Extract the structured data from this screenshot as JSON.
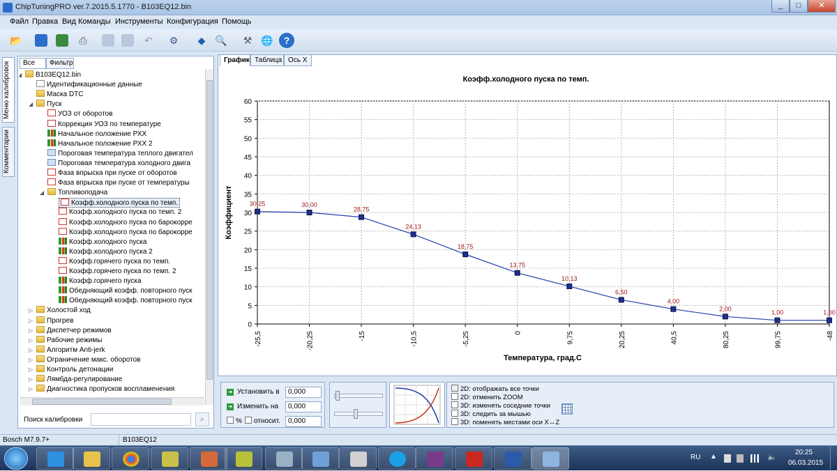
{
  "window": {
    "title": "ChipTuningPRO ver.7.2015.5.1770 - B103EQ12.bin",
    "buttons": [
      "_",
      "□",
      "✕"
    ]
  },
  "menu": [
    "Файл",
    "Правка",
    "Вид",
    "Команды",
    "Инструменты",
    "Конфигурация",
    "Помощь"
  ],
  "side_tabs": [
    "Меню калибровок",
    "Комментарии"
  ],
  "left_panel": {
    "tabs": [
      "Все",
      "Фильтр"
    ],
    "tree": [
      {
        "label": "B103EQ12.bin",
        "icon": "folder-icon",
        "level": 0,
        "expanded": true
      },
      {
        "label": "Идентификационные данные",
        "icon": "id-icon",
        "level": 1
      },
      {
        "label": "Маска DTC",
        "icon": "mask-icon",
        "level": 1
      },
      {
        "label": "Пуск",
        "icon": "folder-icon",
        "level": 1,
        "expanded": true
      },
      {
        "label": "УОЗ от оборотов",
        "icon": "curve-icon",
        "level": 2
      },
      {
        "label": "Коррекция УОЗ по температуре",
        "icon": "curve-icon",
        "level": 2
      },
      {
        "label": "Начальное положение РХХ",
        "icon": "bars-icon",
        "level": 2
      },
      {
        "label": "Начальное положение РХХ 2",
        "icon": "bars-icon",
        "level": 2
      },
      {
        "label": "Пороговая температура теплого двигател",
        "icon": "number-icon",
        "level": 2
      },
      {
        "label": "Пороговая температура холодного двига",
        "icon": "number-icon",
        "level": 2
      },
      {
        "label": "Фаза впрыска при пуске от оборотов",
        "icon": "curve-icon",
        "level": 2
      },
      {
        "label": "Фаза впрыска при пуске от температуры",
        "icon": "curve-icon",
        "level": 2
      },
      {
        "label": "Топливоподача",
        "icon": "folder-icon",
        "level": 2,
        "expanded": true
      },
      {
        "label": "Коэфф.холодного пуска по темп.",
        "icon": "curve-icon",
        "level": 3,
        "selected": true
      },
      {
        "label": "Коэфф.холодного пуска по темп. 2",
        "icon": "curve-icon",
        "level": 3
      },
      {
        "label": "Коэфф.холодного пуска по барокорре",
        "icon": "curve-icon",
        "level": 3
      },
      {
        "label": "Коэфф.холодного пуска по барокорре",
        "icon": "curve-icon",
        "level": 3
      },
      {
        "label": "Коэфф.холодного пуска",
        "icon": "bars-icon",
        "level": 3
      },
      {
        "label": "Коэфф.холодного пуска 2",
        "icon": "bars-icon",
        "level": 3
      },
      {
        "label": "Коэфф.горячего пуска по темп.",
        "icon": "curve-icon",
        "level": 3
      },
      {
        "label": "Коэфф.горячего пуска по темп. 2",
        "icon": "curve-icon",
        "level": 3
      },
      {
        "label": "Коэфф.горячего пуска",
        "icon": "bars-icon",
        "level": 3
      },
      {
        "label": "Обедняющий коэфф. повторного пуск",
        "icon": "bars-icon",
        "level": 3
      },
      {
        "label": "Обедняющий коэфф. повторного пуск",
        "icon": "bars-icon",
        "level": 3
      },
      {
        "label": "Холостой ход",
        "icon": "folder-icon",
        "level": 1
      },
      {
        "label": "Прогрев",
        "icon": "folder-icon",
        "level": 1
      },
      {
        "label": "Диспетчер режимов",
        "icon": "folder-icon",
        "level": 1
      },
      {
        "label": "Рабочие режимы",
        "icon": "folder-icon",
        "level": 1
      },
      {
        "label": "Алгоритм Anti-jerk",
        "icon": "folder-icon",
        "level": 1
      },
      {
        "label": "Ограничение макс. оборотов",
        "icon": "folder-icon",
        "level": 1
      },
      {
        "label": "Контроль детонации",
        "icon": "folder-icon",
        "level": 1
      },
      {
        "label": "Лямбда-регулирование",
        "icon": "folder-icon",
        "level": 1
      },
      {
        "label": "Диагностика пропусков воспламенения",
        "icon": "folder-icon",
        "level": 1
      }
    ],
    "search_label": "Поиск калибровки",
    "search_value": ""
  },
  "right_panel": {
    "tabs": [
      "График",
      "Таблица",
      "Ось X"
    ],
    "active_tab": "График"
  },
  "chart_data": {
    "type": "line",
    "title": "Коэфф.холодного пуска по темп.",
    "xlabel": "Температура, град.С",
    "ylabel": "Коэффициент",
    "categories": [
      "-25,5",
      "-20,25",
      "-15",
      "-10,5",
      "-5,25",
      "0",
      "9,75",
      "20,25",
      "40,5",
      "80,25",
      "99,75",
      "-48"
    ],
    "series": [
      {
        "values": [
          30.25,
          30.0,
          28.75,
          24.13,
          18.75,
          13.75,
          10.13,
          6.5,
          4.0,
          2.0,
          1.0,
          1.0
        ]
      }
    ],
    "point_labels": [
      "30,25",
      "30,00",
      "28,75",
      "24,13",
      "18,75",
      "13,75",
      "10,13",
      "6,50",
      "4,00",
      "2,00",
      "1,00",
      "1,00"
    ],
    "yticks": [
      "0",
      "5",
      "10",
      "15",
      "20",
      "25",
      "30",
      "35",
      "40",
      "45",
      "50",
      "55",
      "60"
    ],
    "ylim": [
      0,
      60
    ],
    "grid": true,
    "line_color": "#1f3fa8",
    "label_color": "#a01818"
  },
  "bottom_panel": {
    "set_label": "Установить в",
    "set_value": "0,000",
    "change_label": "Изменить на",
    "change_value": "0,000",
    "percent_label": "%",
    "relative_label": "относит.",
    "relative_value": "0,000",
    "options": [
      "2D: отображать все точки",
      "2D: отменить ZOOM",
      "3D: изменять соседние точки",
      "3D: следить за мышью",
      "3D: поменять местами оси X↔Z"
    ]
  },
  "status": {
    "ecu": "Bosch M7.9.7+",
    "file": "B103EQ12"
  },
  "taskbar": {
    "lang": "RU",
    "time": "20:25",
    "date": "06.03.2015"
  }
}
